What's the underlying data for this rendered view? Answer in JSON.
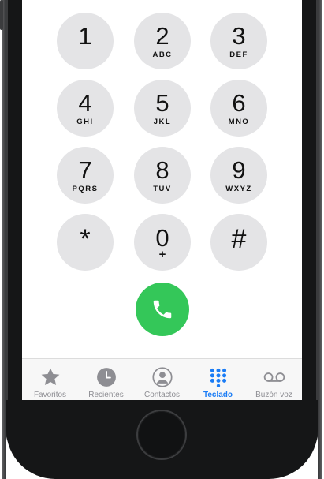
{
  "keypad": {
    "keys": [
      {
        "digit": "1",
        "letters": ""
      },
      {
        "digit": "2",
        "letters": "ABC"
      },
      {
        "digit": "3",
        "letters": "DEF"
      },
      {
        "digit": "4",
        "letters": "GHI"
      },
      {
        "digit": "5",
        "letters": "JKL"
      },
      {
        "digit": "6",
        "letters": "MNO"
      },
      {
        "digit": "7",
        "letters": "PQRS"
      },
      {
        "digit": "8",
        "letters": "TUV"
      },
      {
        "digit": "9",
        "letters": "WXYZ"
      },
      {
        "digit": "*",
        "letters": ""
      },
      {
        "digit": "0",
        "letters": "+"
      },
      {
        "digit": "#",
        "letters": ""
      }
    ]
  },
  "call_button": {
    "icon": "phone-icon",
    "color": "#34c759"
  },
  "tabbar": {
    "tabs": [
      {
        "label": "Favoritos",
        "icon": "star-icon"
      },
      {
        "label": "Recientes",
        "icon": "clock-icon"
      },
      {
        "label": "Contactos",
        "icon": "person-icon"
      },
      {
        "label": "Teclado",
        "icon": "keypad-grid-icon",
        "active": true
      },
      {
        "label": "Buzón voz",
        "icon": "voicemail-icon"
      }
    ],
    "active_color": "#1a7cf5",
    "inactive_color": "#8e8e93"
  }
}
